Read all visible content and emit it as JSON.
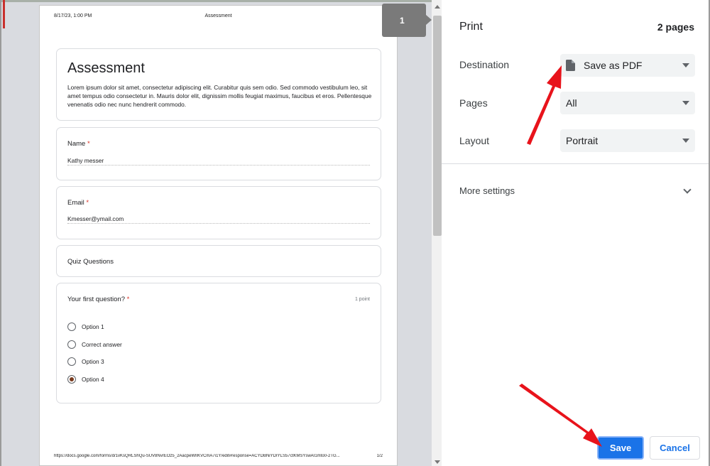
{
  "preview": {
    "page_flag": "1",
    "header": {
      "date": "8/17/23, 1:00 PM",
      "title": "Assessment"
    },
    "footer": {
      "url": "https://docs.google.com/forms/d/1vKsQRLShQu-SUV8NvrEOz5_2AacpeWlIKVCmA7i1Y/edit#response=ACYDBNiYDIYLS57ctKMSYswAI1mto0-2TG...",
      "page_num": "1/2"
    },
    "form": {
      "title": "Assessment",
      "description": "Lorem ipsum dolor sit amet, consectetur adipiscing elit. Curabitur quis sem odio. Sed commodo vestibulum leo, sit amet tempus odio consectetur in. Mauris dolor elit, dignissim mollis feugiat maximus, faucibus et eros. Pellentesque venenatis odio nec nunc hendrerit commodo.",
      "name_label": "Name",
      "name_value": "Kathy messer",
      "email_label": "Email",
      "email_value": "Kmesser@ymail.com",
      "section_title": "Quiz Questions",
      "question": "Your first question?",
      "points": "1 point",
      "required_mark": "*",
      "options": [
        {
          "label": "Option 1",
          "checked": false
        },
        {
          "label": "Correct answer",
          "checked": false
        },
        {
          "label": "Option 3",
          "checked": false
        },
        {
          "label": "Option 4",
          "checked": true
        }
      ]
    }
  },
  "panel": {
    "title": "Print",
    "page_count": "2 pages",
    "destination_label": "Destination",
    "destination_value": "Save as PDF",
    "pages_label": "Pages",
    "pages_value": "All",
    "layout_label": "Layout",
    "layout_value": "Portrait",
    "more_settings": "More settings",
    "save_label": "Save",
    "cancel_label": "Cancel"
  },
  "colors": {
    "primary_blue": "#1a73e8",
    "annotation_red": "#e8131b",
    "selected_radio": "#7a3b1e",
    "required_red": "#d93025"
  }
}
